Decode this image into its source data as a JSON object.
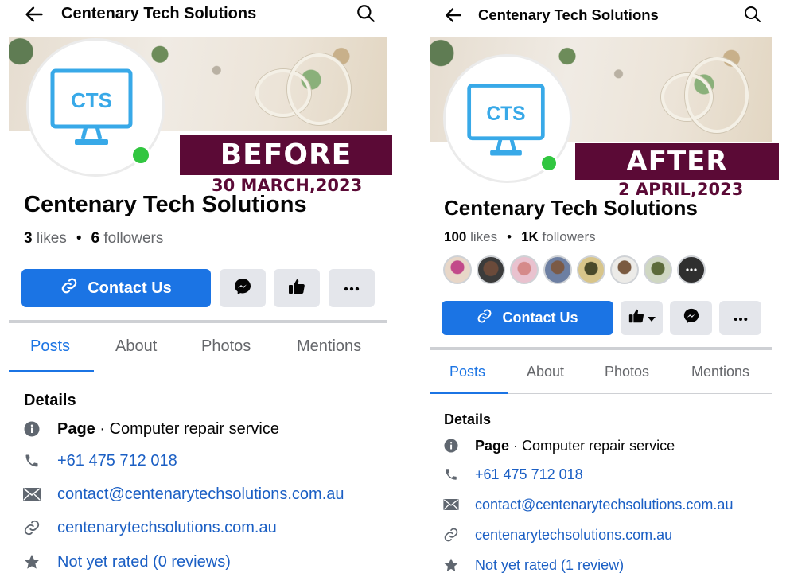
{
  "before": {
    "header_title": "Centenary Tech Solutions",
    "logo_text": "CTS",
    "banner_label": "BEFORE",
    "banner_date": "30 MARCH,2023",
    "page_name": "Centenary Tech Solutions",
    "likes_count": "3",
    "likes_label": "likes",
    "followers_count": "6",
    "followers_label": "followers",
    "contact_label": "Contact Us",
    "tabs": [
      "Posts",
      "About",
      "Photos",
      "Mentions"
    ],
    "active_tab": "Posts",
    "details_title": "Details",
    "category_prefix": "Page",
    "category": "· Computer repair service",
    "phone": "+61 475 712 018",
    "email": "contact@centenarytechsolutions.com.au",
    "website": "centenarytechsolutions.com.au",
    "rating": "Not yet rated (0 reviews)"
  },
  "after": {
    "header_title": "Centenary Tech Solutions",
    "logo_text": "CTS",
    "banner_label": "AFTER",
    "banner_date": "2 APRIL,2023",
    "page_name": "Centenary Tech Solutions",
    "likes_count": "100",
    "likes_label": "likes",
    "followers_count": "1K",
    "followers_label": "followers",
    "contact_label": "Contact Us",
    "tabs": [
      "Posts",
      "About",
      "Photos",
      "Mentions"
    ],
    "active_tab": "Posts",
    "details_title": "Details",
    "category_prefix": "Page",
    "category": "· Computer repair service",
    "phone": "+61 475 712 018",
    "email": "contact@centenarytechsolutions.com.au",
    "website": "centenarytechsolutions.com.au",
    "rating": "Not yet rated (1 review)",
    "follower_avatars": 8
  },
  "colors": {
    "primary": "#1b74e4",
    "link": "#1b5fc4",
    "banner": "#5b0a36",
    "online": "#31c640",
    "logo": "#38a9e8",
    "muted": "#65676b"
  },
  "icons": [
    "back-arrow-icon",
    "search-icon",
    "link-icon",
    "messenger-icon",
    "thumbs-up-icon",
    "more-icon",
    "info-icon",
    "phone-icon",
    "mail-icon",
    "link-icon",
    "star-icon"
  ]
}
